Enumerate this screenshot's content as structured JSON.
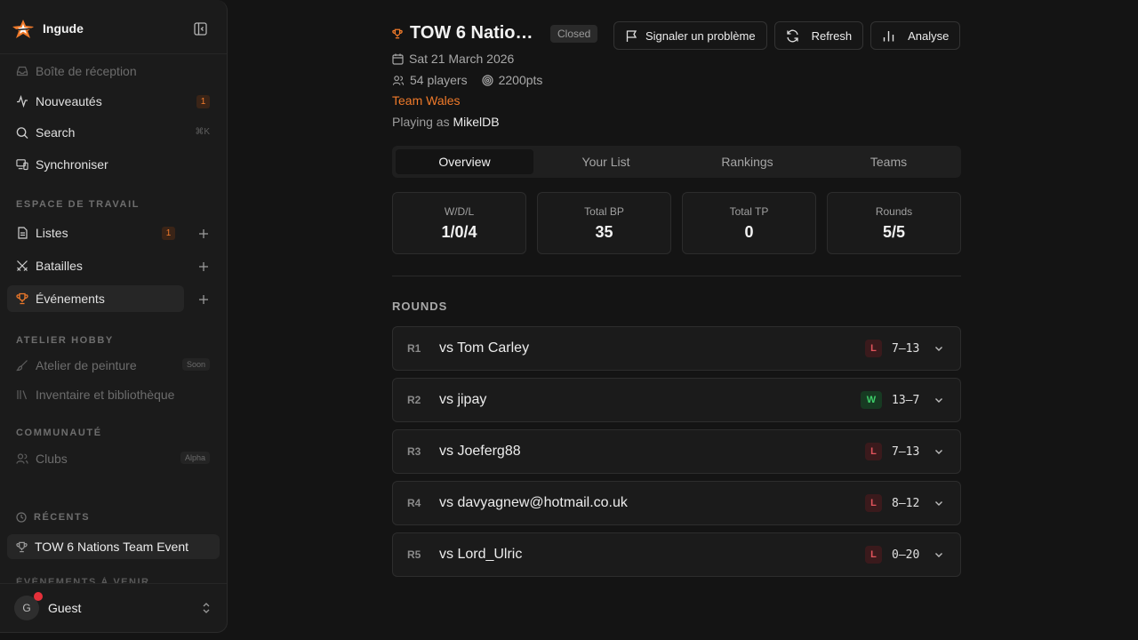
{
  "app": {
    "name": "Ingude"
  },
  "sidebar": {
    "items": {
      "inbox": "Boîte de réception",
      "news": "Nouveautés",
      "news_count": "1",
      "search": "Search",
      "search_shortcut": "⌘K",
      "sync": "Synchroniser",
      "lists": "Listes",
      "lists_count": "1",
      "battles": "Batailles",
      "events": "Événements",
      "paint": "Atelier de peinture",
      "paint_badge": "Soon",
      "inventory": "Inventaire et bibliothèque",
      "clubs": "Clubs",
      "clubs_badge": "Alpha"
    },
    "sections": {
      "workspace": "ESPACE DE TRAVAIL",
      "hobby": "ATELIER HOBBY",
      "community": "COMMUNAUTÉ",
      "recents": "RÉCENTS",
      "upcoming": "ÉVÉNEMENTS À VENIR"
    },
    "recent_item": "TOW 6 Nations Team Event",
    "user": {
      "initial": "G",
      "name": "Guest"
    }
  },
  "event": {
    "title": "TOW 6 Nations Team Event",
    "status": "Closed",
    "date": "Sat 21 March 2026",
    "players": "54 players",
    "points": "2200pts",
    "team": "Team Wales",
    "playing_as_label": "Playing as",
    "playing_as_name": "MikelDB"
  },
  "actions": {
    "report": "Signaler un problème",
    "refresh": "Refresh",
    "analyse": "Analyse"
  },
  "tabs": [
    "Overview",
    "Your List",
    "Rankings",
    "Teams"
  ],
  "stats": [
    {
      "label": "W/D/L",
      "value": "1/0/4"
    },
    {
      "label": "Total BP",
      "value": "35"
    },
    {
      "label": "Total TP",
      "value": "0"
    },
    {
      "label": "Rounds",
      "value": "5/5"
    }
  ],
  "rounds_title": "ROUNDS",
  "rounds": [
    {
      "num": "R1",
      "opponent": "vs Tom Carley",
      "result": "L",
      "score": "7–13"
    },
    {
      "num": "R2",
      "opponent": "vs jipay",
      "result": "W",
      "score": "13–7"
    },
    {
      "num": "R3",
      "opponent": "vs Joeferg88",
      "result": "L",
      "score": "7–13"
    },
    {
      "num": "R4",
      "opponent": "vs davyagnew@hotmail.co.uk",
      "result": "L",
      "score": "8–12"
    },
    {
      "num": "R5",
      "opponent": "vs Lord_Ulric",
      "result": "L",
      "score": "0–20"
    }
  ],
  "colors": {
    "accent": "#f07a2a",
    "win": "#3ecf6a",
    "loss": "#e2545c",
    "bg": "#141414",
    "sidebar": "#1b1b1b"
  }
}
